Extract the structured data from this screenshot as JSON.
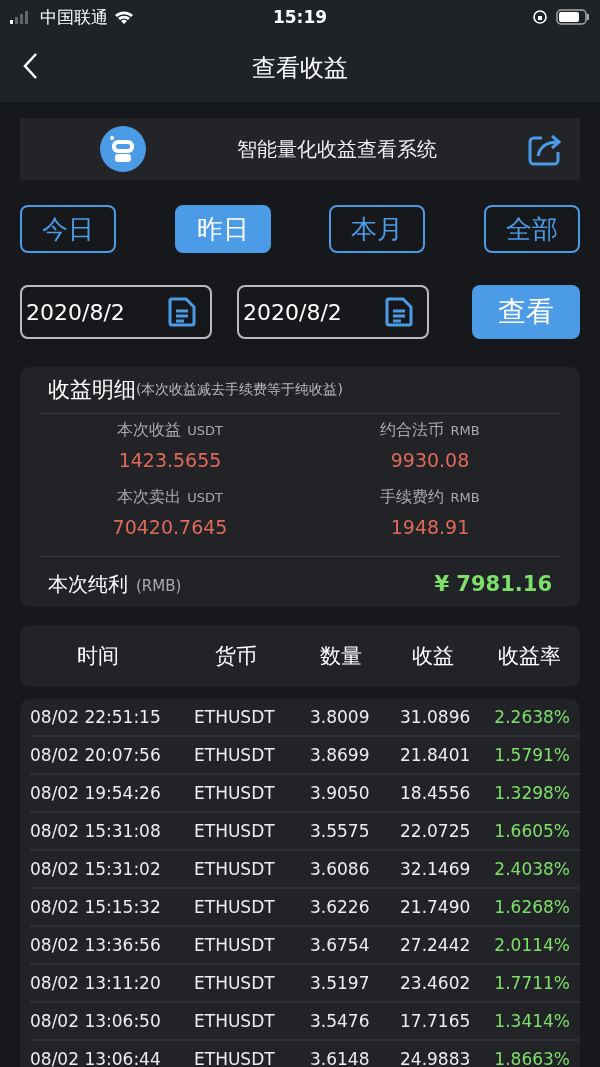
{
  "status_bar": {
    "carrier": "中国联通",
    "time": "15:19"
  },
  "nav": {
    "title": "查看收益"
  },
  "banner": {
    "title": "智能量化收益查看系统"
  },
  "periods": [
    {
      "label": "今日",
      "selected": false
    },
    {
      "label": "昨日",
      "selected": true
    },
    {
      "label": "本月",
      "selected": false
    },
    {
      "label": "全部",
      "selected": false
    }
  ],
  "date_range": {
    "start": "2020/8/2",
    "end": "2020/8/2",
    "button": "查看"
  },
  "summary": {
    "title": "收益明细",
    "note": "(本次收益减去手续费等于纯收益)",
    "items": [
      {
        "label": "本次收益",
        "unit": "USDT",
        "value": "1423.5655"
      },
      {
        "label": "约合法币",
        "unit": "RMB",
        "value": "9930.08"
      },
      {
        "label": "本次卖出",
        "unit": "USDT",
        "value": "70420.7645"
      },
      {
        "label": "手续费约",
        "unit": "RMB",
        "value": "1948.91"
      }
    ],
    "net_label": "本次纯利",
    "net_unit": "(RMB)",
    "net_value": "¥ 7981.16"
  },
  "table": {
    "columns": [
      "时间",
      "货币",
      "数量",
      "收益",
      "收益率"
    ],
    "rows": [
      [
        "08/02 22:51:15",
        "ETHUSDT",
        "3.8009",
        "31.0896",
        "2.2638%"
      ],
      [
        "08/02 20:07:56",
        "ETHUSDT",
        "3.8699",
        "21.8401",
        "1.5791%"
      ],
      [
        "08/02 19:54:26",
        "ETHUSDT",
        "3.9050",
        "18.4556",
        "1.3298%"
      ],
      [
        "08/02 15:31:08",
        "ETHUSDT",
        "3.5575",
        "22.0725",
        "1.6605%"
      ],
      [
        "08/02 15:31:02",
        "ETHUSDT",
        "3.6086",
        "32.1469",
        "2.4038%"
      ],
      [
        "08/02 15:15:32",
        "ETHUSDT",
        "3.6226",
        "21.7490",
        "1.6268%"
      ],
      [
        "08/02 13:36:56",
        "ETHUSDT",
        "3.6754",
        "27.2442",
        "2.0114%"
      ],
      [
        "08/02 13:11:20",
        "ETHUSDT",
        "3.5197",
        "23.4602",
        "1.7711%"
      ],
      [
        "08/02 13:06:50",
        "ETHUSDT",
        "3.5476",
        "17.7165",
        "1.3414%"
      ],
      [
        "08/02 13:06:44",
        "ETHUSDT",
        "3.6148",
        "24.9883",
        "1.8663%"
      ]
    ]
  }
}
